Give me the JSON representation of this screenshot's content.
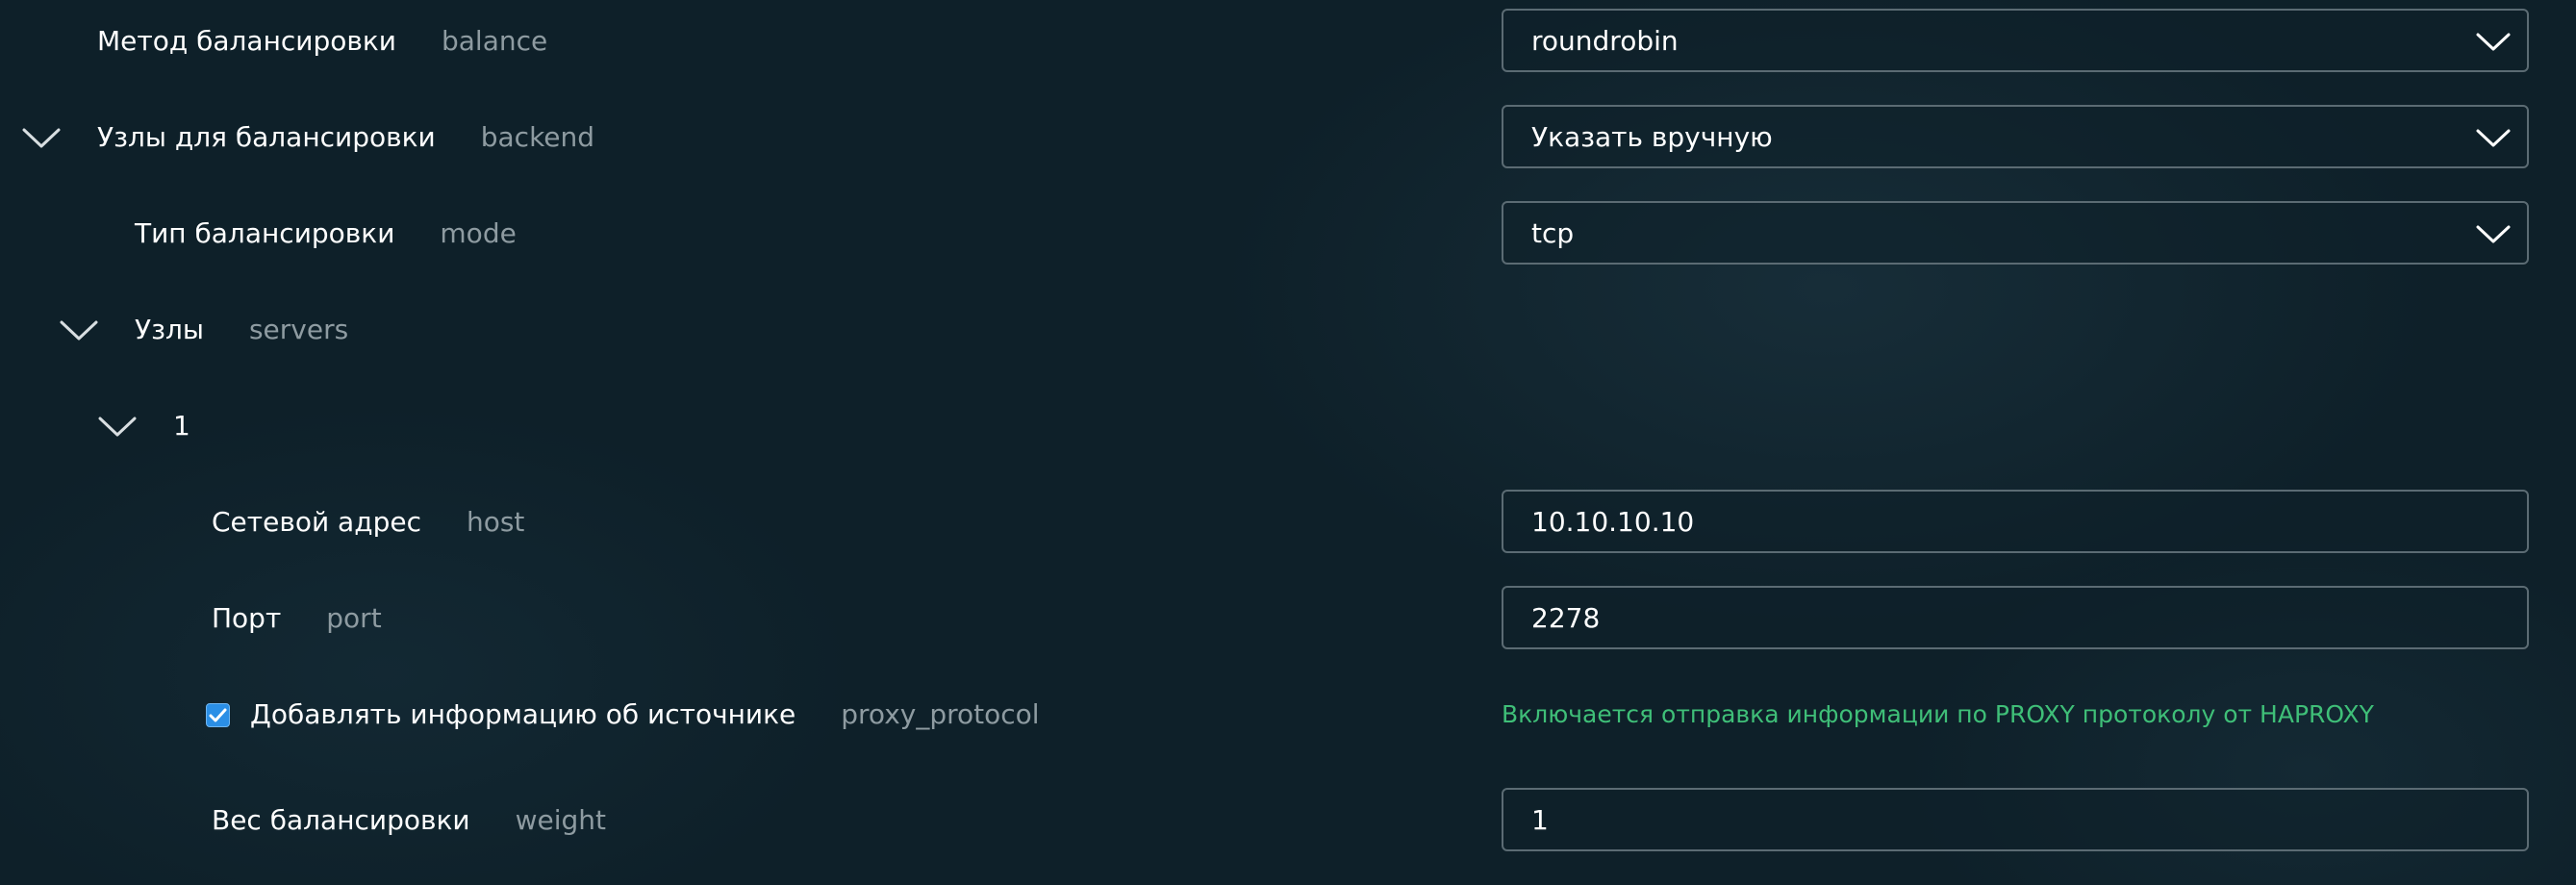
{
  "fields": {
    "balance": {
      "label": "Метод балансировки",
      "key": "balance",
      "value": "roundrobin"
    },
    "backend": {
      "label": "Узлы для балансировки",
      "key": "backend",
      "value": "Указать вручную"
    },
    "mode": {
      "label": "Тип балансировки",
      "key": "mode",
      "value": "tcp"
    },
    "servers": {
      "label": "Узлы",
      "key": "servers"
    },
    "server_item": {
      "label": "1"
    },
    "host": {
      "label": "Сетевой адрес",
      "key": "host",
      "value": "10.10.10.10"
    },
    "port": {
      "label": "Порт",
      "key": "port",
      "value": "2278"
    },
    "proxy_protocol": {
      "label": "Добавлять информацию об источнике",
      "key": "proxy_protocol",
      "checked": true,
      "hint": "Включается отправка информации по PROXY протоколу от HAPROXY"
    },
    "weight": {
      "label": "Вес балансировки",
      "key": "weight",
      "value": "1"
    }
  },
  "colors": {
    "background": "#0e2029",
    "label_text": "#ffffff",
    "key_text": "#8e9ba1",
    "input_border": "#5b6b73",
    "hint_text": "#3fbf78",
    "checkbox_fill": "#2b8fe6"
  },
  "icons": {
    "collapse": "chevron-down-icon",
    "dropdown": "chevron-down-icon",
    "checkbox_mark": "check-icon"
  }
}
